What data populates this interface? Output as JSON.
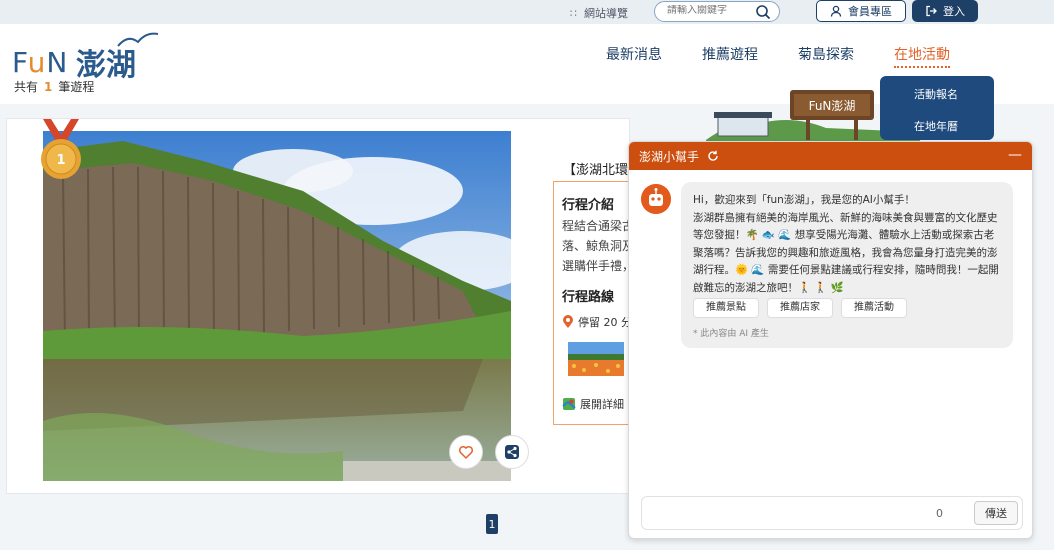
{
  "topbar": {
    "sitemap_label": "網站導覽",
    "search_placeholder": "請輸入關鍵字",
    "member_label": "會員專區",
    "login_label": "登入"
  },
  "logo": {
    "count_prefix": "共有",
    "count_value": "1",
    "count_suffix": "筆遊程",
    "zh": "澎湖"
  },
  "nav": {
    "items": [
      "最新消息",
      "推薦遊程",
      "菊島探索",
      "在地活動"
    ],
    "active_index": 3
  },
  "dropdown": {
    "items": [
      "活動報名",
      "在地年曆"
    ]
  },
  "banner": {
    "sign_text": "FuN澎湖"
  },
  "card": {
    "rank": "1",
    "title": "【澎湖北環】",
    "intro_heading": "行程介紹",
    "intro_lines": [
      "程結合通梁古",
      "落、鯨魚洞及",
      "選購伴手禮，"
    ],
    "route_heading": "行程路線",
    "stay_text": "停留 20 分",
    "expand_text": "展開詳細"
  },
  "pager": {
    "current": "1"
  },
  "chat": {
    "title": "澎湖小幫手",
    "minimize": "—",
    "message": "Hi，歡迎來到「fun澎湖」，我是您的AI小幫手！\n澎湖群島擁有絕美的海岸風光、新鮮的海味美食與豐富的文化歷史等您發掘！🌴 🐟 🌊 想享受陽光海灘、體驗水上活動或探索古老聚落嗎？告訴我您的興趣和旅遊風格，我會為您量身打造完美的澎湖行程。🌞 🌊 需要任何景點建議或行程安排，隨時問我！一起開啟難忘的澎湖之旅吧！🚶 🚶 🌿",
    "chips": [
      "推薦景點",
      "推薦店家",
      "推薦活動"
    ],
    "ai_note": "* 此內容由 AI 產生",
    "char_count": "0",
    "send_label": "傳送"
  },
  "colors": {
    "brand_navy": "#1e3f66",
    "accent_orange": "#e2632b",
    "chat_header": "#cc4f10"
  }
}
